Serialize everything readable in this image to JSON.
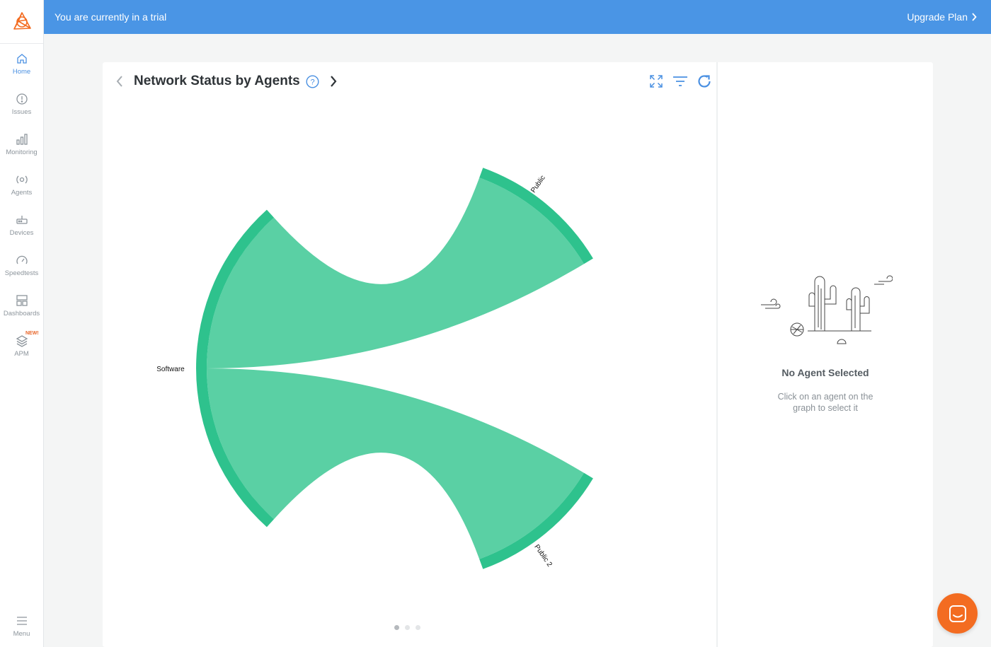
{
  "banner": {
    "text": "You are currently in a trial",
    "upgrade_label": "Upgrade Plan"
  },
  "sidebar": {
    "items": [
      {
        "label": "Home",
        "icon": "home-icon",
        "active": true
      },
      {
        "label": "Issues",
        "icon": "alert-circle-icon"
      },
      {
        "label": "Monitoring",
        "icon": "bar-chart-icon"
      },
      {
        "label": "Agents",
        "icon": "agent-radar-icon"
      },
      {
        "label": "Devices",
        "icon": "router-icon"
      },
      {
        "label": "Speedtests",
        "icon": "speedometer-icon"
      },
      {
        "label": "Dashboards",
        "icon": "dashboard-grid-icon"
      },
      {
        "label": "APM",
        "icon": "layers-icon",
        "badge": "NEW!"
      }
    ],
    "menu_label": "Menu"
  },
  "widget": {
    "title": "Network Status by Agents",
    "pagination": {
      "pages": 3,
      "active": 0
    }
  },
  "chart_data": {
    "type": "chord",
    "nodes": [
      "Software",
      "Public",
      "Public 2"
    ],
    "links": [
      {
        "source": "Software",
        "target": "Public"
      },
      {
        "source": "Software",
        "target": "Public 2"
      }
    ],
    "colors": {
      "arc": "#2ec28d",
      "ribbon": "#5ad0a4"
    }
  },
  "empty_state": {
    "title": "No Agent Selected",
    "subtitle": "Click on an agent on the graph to select it"
  },
  "colors": {
    "accent": "#4a90e2",
    "banner": "#4a95e5",
    "chat": "#f36c21"
  }
}
